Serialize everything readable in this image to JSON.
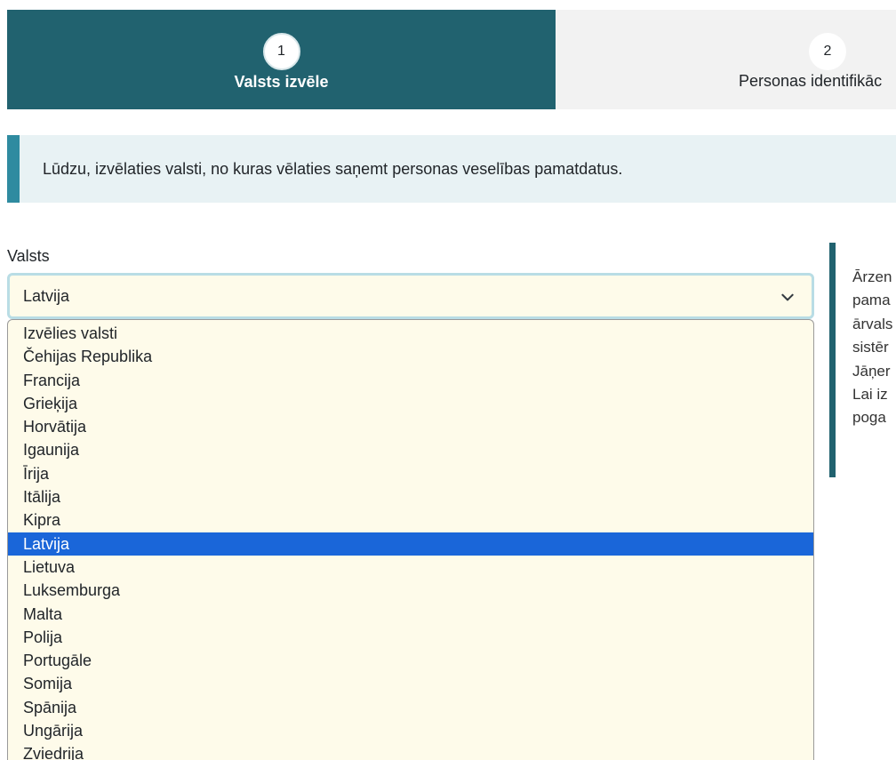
{
  "stepper": {
    "steps": [
      {
        "number": "1",
        "label": "Valsts izvēle",
        "active": true
      },
      {
        "number": "2",
        "label": "Personas identifikāc",
        "active": false
      }
    ]
  },
  "alert": {
    "text": "Lūdzu, izvēlaties valsti, no kuras vēlaties saņemt personas veselības pamatdatus."
  },
  "country_field": {
    "label": "Valsts",
    "selected_value": "Latvija",
    "options": [
      "Izvēlies valsti",
      "Čehijas Republika",
      "Francija",
      "Grieķija",
      "Horvātija",
      "Igaunija",
      "Īrija",
      "Itālija",
      "Kipra",
      "Latvija",
      "Lietuva",
      "Luksemburga",
      "Malta",
      "Polija",
      "Portugāle",
      "Somija",
      "Spānija",
      "Ungārija",
      "Zviedrija"
    ],
    "highlighted_index": 9
  },
  "side_panel": {
    "lines": [
      "Ārzen",
      "pama",
      "ārvals",
      "sistēr",
      "Jāņer",
      "Lai iz",
      "poga"
    ]
  },
  "colors": {
    "step_active_bg": "#21626f",
    "step_inactive_bg": "#f2f2f2",
    "alert_bg": "#e8f2f4",
    "alert_border": "#2f8ba0",
    "select_bg": "#fefbea",
    "option_highlight": "#1a66d9"
  }
}
